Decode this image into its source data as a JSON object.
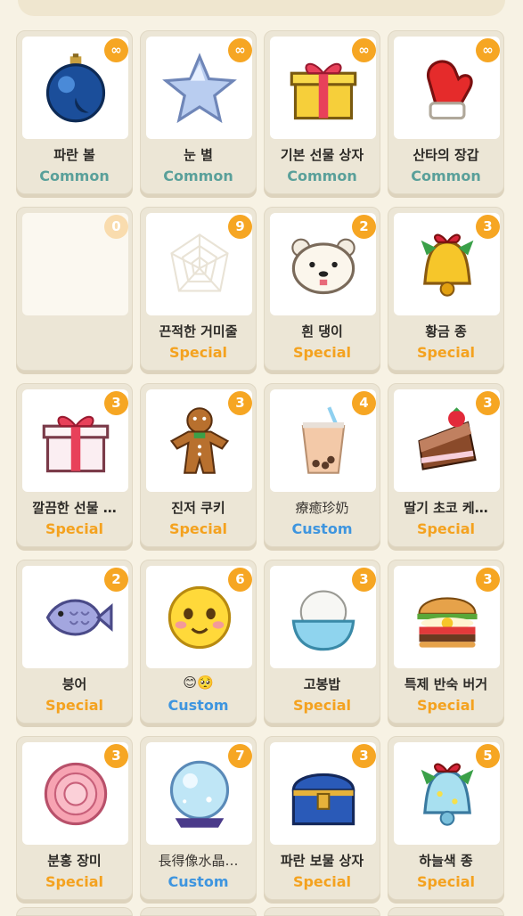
{
  "items": [
    {
      "name": "파란 볼",
      "rarity": "Common",
      "count": "∞",
      "icon": "blue-ornament-icon"
    },
    {
      "name": "눈 별",
      "rarity": "Common",
      "count": "∞",
      "icon": "snow-star-icon"
    },
    {
      "name": "기본 선물 상자",
      "rarity": "Common",
      "count": "∞",
      "icon": "gift-box-icon"
    },
    {
      "name": "산타의 장갑",
      "rarity": "Common",
      "count": "∞",
      "icon": "santa-mitten-icon"
    },
    {
      "name": "",
      "rarity": "",
      "count": "0",
      "icon": "hidden-item-icon"
    },
    {
      "name": "끈적한 거미줄",
      "rarity": "Special",
      "count": "9",
      "icon": "spider-web-icon"
    },
    {
      "name": "흰 댕이",
      "rarity": "Special",
      "count": "2",
      "icon": "white-dog-icon"
    },
    {
      "name": "황금 종",
      "rarity": "Special",
      "count": "3",
      "icon": "golden-bell-icon"
    },
    {
      "name": "깔끔한 선물 …",
      "rarity": "Special",
      "count": "3",
      "icon": "neat-gift-icon"
    },
    {
      "name": "진저 쿠키",
      "rarity": "Special",
      "count": "3",
      "icon": "gingerbread-icon"
    },
    {
      "name": "療癒珍奶",
      "rarity": "Custom",
      "count": "4",
      "icon": "bubble-tea-icon"
    },
    {
      "name": "딸기 초코 케…",
      "rarity": "Special",
      "count": "3",
      "icon": "strawberry-cake-icon"
    },
    {
      "name": "붕어",
      "rarity": "Special",
      "count": "2",
      "icon": "fish-bun-icon"
    },
    {
      "name": "😊🥺",
      "rarity": "Custom",
      "count": "6",
      "icon": "smiley-icon"
    },
    {
      "name": "고봉밥",
      "rarity": "Special",
      "count": "3",
      "icon": "rice-bowl-icon"
    },
    {
      "name": "특제 반숙 버거",
      "rarity": "Special",
      "count": "3",
      "icon": "burger-icon"
    },
    {
      "name": "분홍 장미",
      "rarity": "Special",
      "count": "3",
      "icon": "pink-rose-icon"
    },
    {
      "name": "長得像水晶…",
      "rarity": "Custom",
      "count": "7",
      "icon": "crystal-ball-icon"
    },
    {
      "name": "파란 보물 상자",
      "rarity": "Special",
      "count": "3",
      "icon": "treasure-chest-icon"
    },
    {
      "name": "하늘색 종",
      "rarity": "Special",
      "count": "5",
      "icon": "sky-bell-icon"
    }
  ],
  "colors": {
    "common": "#5aa09a",
    "special": "#f4a21f",
    "custom": "#3e95df",
    "badge": "#f6a623"
  }
}
